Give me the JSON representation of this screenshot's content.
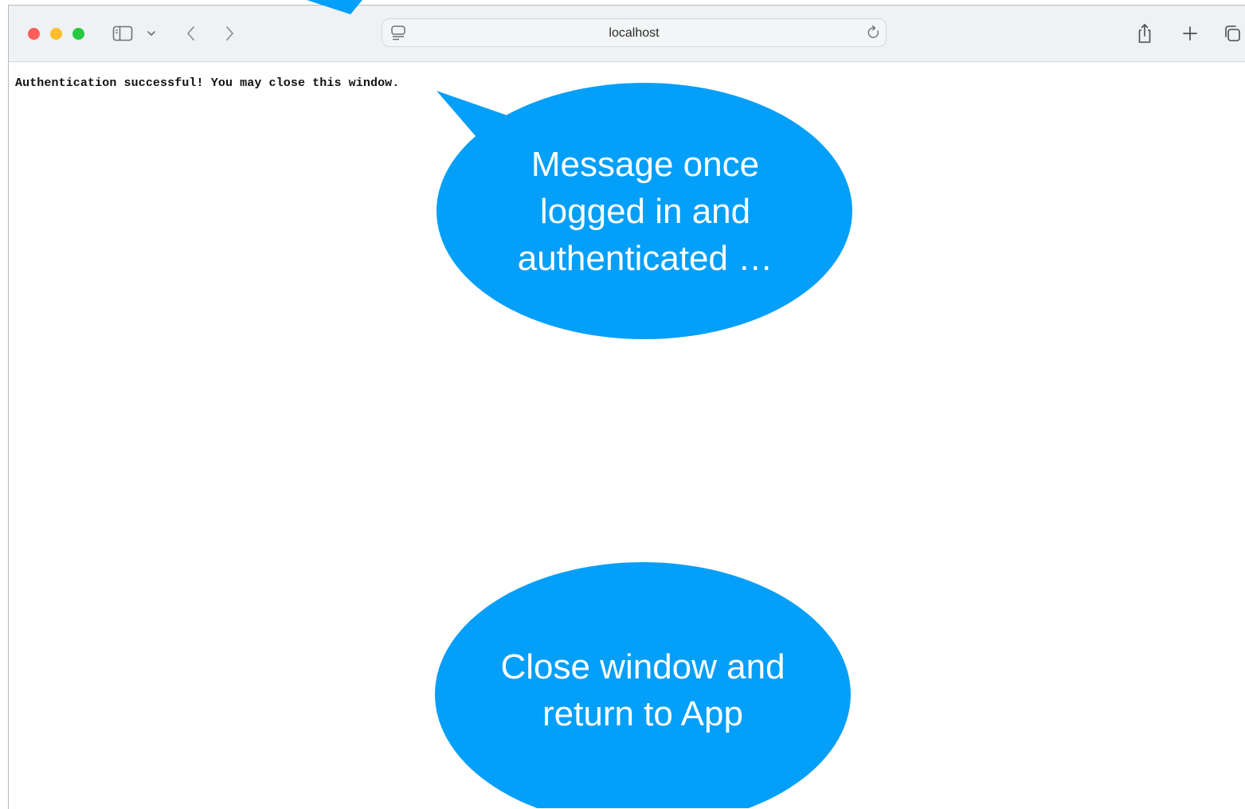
{
  "browser": {
    "address": "localhost",
    "colors": {
      "close": "#fe5f57",
      "minimize": "#febc2e",
      "maximize": "#28c840",
      "toolbar_bg": "#eef2f4",
      "icon": "#6e7173"
    },
    "icons": {
      "close": "close-window-dot",
      "minimize": "minimize-window-dot",
      "maximize": "maximize-window-dot",
      "sidebar": "sidebar-icon",
      "tab_group_menu": "chevron-down-icon",
      "back": "chevron-left-icon",
      "forward": "chevron-right-icon",
      "page_menu": "page-menu-icon",
      "reload": "reload-icon",
      "share": "share-icon",
      "new_tab": "plus-icon",
      "tab_overview": "tab-overview-icon"
    }
  },
  "page": {
    "message": "Authentication successful! You may close this window."
  },
  "callouts": {
    "color": "#049ff8",
    "message_note": {
      "line1": "Message once",
      "line2": "logged in and",
      "line3": "authenticated …"
    },
    "close_note": {
      "line1": "Close window and",
      "line2": "return to App"
    }
  }
}
